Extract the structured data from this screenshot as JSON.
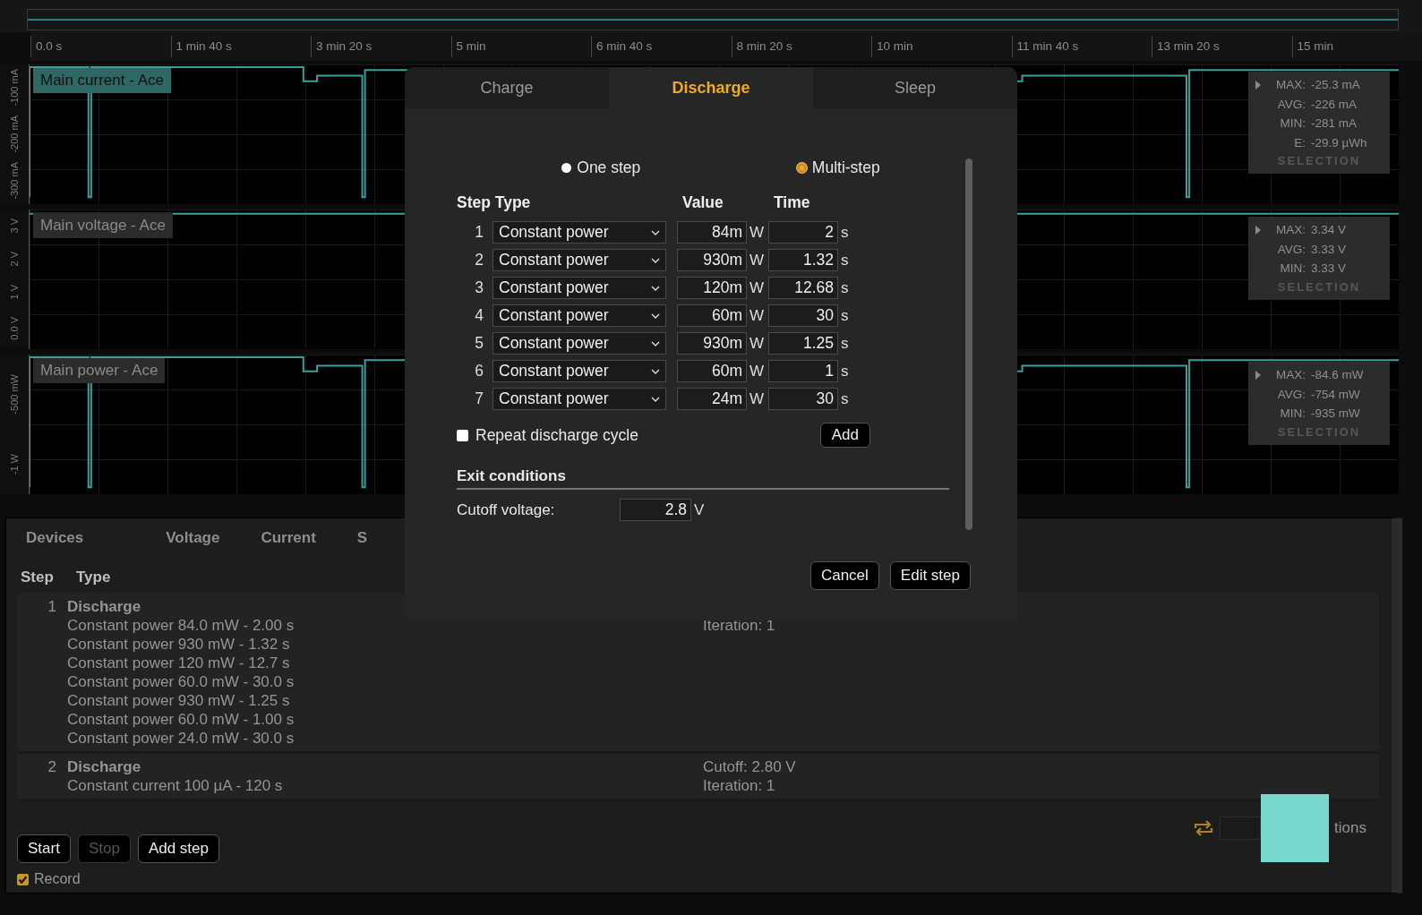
{
  "time_axis": {
    "ticks": [
      "0.0 s",
      "1 min 40 s",
      "3 min 20 s",
      "5 min",
      "6 min 40 s",
      "8 min 20 s",
      "10 min",
      "11 min 40 s",
      "13 min 20 s",
      "15 min"
    ]
  },
  "charts": [
    {
      "kind": "spiky",
      "label": "Main current - Ace",
      "selected": true,
      "y_ticks": [
        "-300 mA",
        "-200 mA",
        "-100 mA"
      ],
      "stats": [
        {
          "label": "MAX:",
          "value": "-25.3 mA"
        },
        {
          "label": "AVG:",
          "value": "-226 mA"
        },
        {
          "label": "MIN:",
          "value": "-281 mA"
        },
        {
          "label": "E:",
          "value": "-29.9 µWh"
        }
      ],
      "stats_footer": "SELECTION"
    },
    {
      "kind": "flat",
      "label": "Main voltage - Ace",
      "selected": false,
      "y_ticks": [
        "0.0 V",
        "1 V",
        "2 V",
        "3 V"
      ],
      "stats": [
        {
          "label": "MAX:",
          "value": "3.34 V"
        },
        {
          "label": "AVG:",
          "value": "3.33 V"
        },
        {
          "label": "MIN:",
          "value": "3.33 V"
        }
      ],
      "stats_footer": "SELECTION"
    },
    {
      "kind": "spiky",
      "label": "Main power - Ace",
      "selected": false,
      "y_ticks": [
        "-1 W",
        "-500 mW"
      ],
      "stats": [
        {
          "label": "MAX:",
          "value": "-84.6 mW"
        },
        {
          "label": "AVG:",
          "value": "-754 mW"
        },
        {
          "label": "MIN:",
          "value": "-935 mW"
        }
      ],
      "stats_footer": "SELECTION"
    }
  ],
  "bottom_panel": {
    "tabs": [
      "Devices",
      "Voltage",
      "Current",
      "S"
    ],
    "table": {
      "columns": [
        "Step",
        "Type"
      ],
      "rows": [
        {
          "step": "1",
          "title": "Discharge",
          "lines": [
            "Constant power 84.0 mW - 2.00 s",
            "Constant power 930 mW - 1.32 s",
            "Constant power 120 mW - 12.7 s",
            "Constant power 60.0 mW - 30.0 s",
            "Constant power 930 mW - 1.25 s",
            "Constant power 60.0 mW - 1.00 s",
            "Constant power 24.0 mW - 30.0 s"
          ],
          "notes": [
            "Iteration: 1"
          ]
        },
        {
          "step": "2",
          "title": "Discharge",
          "lines": [
            "Constant current 100 µA - 120 s"
          ],
          "notes": [
            "Cutoff: 2.80 V",
            "Iteration: 1"
          ]
        }
      ]
    },
    "iterations_label": "tions",
    "buttons": [
      {
        "label": "Start",
        "disabled": false
      },
      {
        "label": "Stop",
        "disabled": true
      },
      {
        "label": "Add step",
        "disabled": false
      }
    ],
    "record": {
      "label": "Record",
      "checked": true
    }
  },
  "dialog": {
    "tabs": [
      {
        "label": "Charge",
        "selected": false
      },
      {
        "label": "Discharge",
        "selected": true
      },
      {
        "label": "Sleep",
        "selected": false
      }
    ],
    "modes": [
      {
        "label": "One step",
        "selected": false
      },
      {
        "label": "Multi-step",
        "selected": true
      }
    ],
    "columns": [
      "Step Type",
      "Value",
      "Time"
    ],
    "steps": [
      {
        "number": "1",
        "type": "Constant power",
        "value": "84m",
        "value_unit": "W",
        "time": "2",
        "time_unit": "s"
      },
      {
        "number": "2",
        "type": "Constant power",
        "value": "930m",
        "value_unit": "W",
        "time": "1.32",
        "time_unit": "s"
      },
      {
        "number": "3",
        "type": "Constant power",
        "value": "120m",
        "value_unit": "W",
        "time": "12.68",
        "time_unit": "s"
      },
      {
        "number": "4",
        "type": "Constant power",
        "value": "60m",
        "value_unit": "W",
        "time": "30",
        "time_unit": "s"
      },
      {
        "number": "5",
        "type": "Constant power",
        "value": "930m",
        "value_unit": "W",
        "time": "1.25",
        "time_unit": "s"
      },
      {
        "number": "6",
        "type": "Constant power",
        "value": "60m",
        "value_unit": "W",
        "time": "1",
        "time_unit": "s"
      },
      {
        "number": "7",
        "type": "Constant power",
        "value": "24m",
        "value_unit": "W",
        "time": "30",
        "time_unit": "s"
      }
    ],
    "repeat": {
      "label": "Repeat discharge cycle",
      "checked": false
    },
    "add_button": "Add",
    "exit_conditions": {
      "title": "Exit conditions",
      "cutoff_label": "Cutoff voltage:",
      "cutoff_value": "2.8",
      "cutoff_unit": "V"
    },
    "buttons": [
      "Cancel",
      "Edit step"
    ]
  }
}
